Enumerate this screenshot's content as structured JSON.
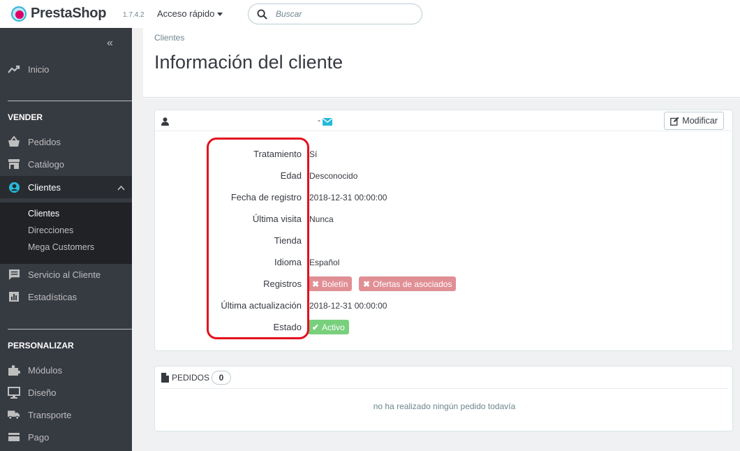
{
  "header": {
    "brand": "PrestaShop",
    "version": "1.7.4.2",
    "quick_access": "Acceso rápido",
    "search_placeholder": "Buscar"
  },
  "sidebar": {
    "home": "Inicio",
    "section_sell": "VENDER",
    "orders": "Pedidos",
    "catalog": "Catálogo",
    "customers": "Clientes",
    "submenu": [
      "Clientes",
      "Direcciones",
      "Mega Customers"
    ],
    "customer_service": "Servicio al Cliente",
    "stats": "Estadísticas",
    "section_customize": "PERSONALIZAR",
    "modules": "Módulos",
    "design": "Diseño",
    "shipping": "Transporte",
    "payment": "Pago"
  },
  "page": {
    "breadcrumb": "Clientes",
    "title": "Información del cliente"
  },
  "customer_panel": {
    "header_separator": "-",
    "modify_label": "Modificar",
    "rows": [
      {
        "label": "Tratamiento",
        "value": "Sí"
      },
      {
        "label": "Edad",
        "value": "Desconocido"
      },
      {
        "label": "Fecha de registro",
        "value": "2018-12-31 00:00:00"
      },
      {
        "label": "Última visita",
        "value": "Nunca"
      },
      {
        "label": "Tienda",
        "value": ""
      },
      {
        "label": "Idioma",
        "value": "Español"
      },
      {
        "label": "Registros",
        "value": ""
      },
      {
        "label": "Última actualización",
        "value": "2018-12-31 00:00:00"
      },
      {
        "label": "Estado",
        "value": ""
      }
    ],
    "badge_newsletter": "Boletín",
    "badge_partners": "Ofertas de asociados",
    "badge_status": "Activo"
  },
  "orders_panel": {
    "title": "PEDIDOS",
    "count": "0",
    "empty_message": "no ha realizado ningún pedido todavía"
  },
  "colors": {
    "sidebar_bg": "#363a41",
    "accent": "#25b9d7",
    "badge_red": "#e08f95",
    "badge_green": "#78d07d",
    "annotation_red": "#e3101e"
  }
}
